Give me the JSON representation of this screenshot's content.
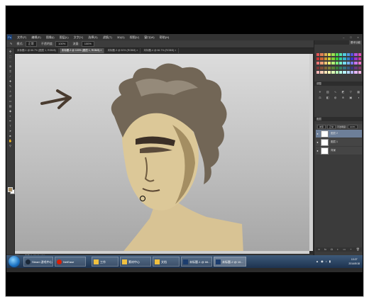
{
  "menubar": {
    "app_icon": "Ps",
    "items": [
      "文件(F)",
      "编辑(E)",
      "图像(I)",
      "图层(L)",
      "文字(Y)",
      "选择(S)",
      "滤镜(T)",
      "3D(D)",
      "视图(V)",
      "窗口(W)",
      "帮助(H)"
    ],
    "window_controls": [
      "–",
      "□",
      "×"
    ]
  },
  "options_bar": {
    "mode_label": "模式:",
    "mode_value": "正常",
    "opacity_label": "不透明度:",
    "opacity_value": "100%",
    "flow_label": "流量:",
    "flow_value": "100%"
  },
  "document_tabs": [
    {
      "label": "未标题-1 @ 66.7% (图层 1, RGB/8)",
      "active": false
    },
    {
      "label": "未标题-2 @ 100% (图层 1, RGB/8) ×",
      "active": true
    },
    {
      "label": "未标题-3 @ 50% (RGB/8) ×",
      "active": false
    },
    {
      "label": "未标题-4 @ 66.7% (RGB/8) ×",
      "active": false
    }
  ],
  "status_bar": {
    "zoom": "20%",
    "doc_size": "文档:3.43M/2.46M"
  },
  "panels": {
    "workspace": "基本功能",
    "adjustments_title": "调整",
    "layers_title": "图层",
    "layers_kind": "类型",
    "layers_mode": "正常",
    "opacity_label": "不透明度:",
    "opacity_value": "100%",
    "layers": [
      {
        "name": "图层 2",
        "selected": true
      },
      {
        "name": "图层 1",
        "selected": false
      },
      {
        "name": "背景",
        "selected": false
      }
    ]
  },
  "taskbar": {
    "buttons": [
      {
        "label": "Steam 游戏中心",
        "icon": "steam-icon"
      },
      {
        "label": "NetEase",
        "icon": "netease-icon"
      },
      {
        "label": "工作",
        "icon": "folder-icon"
      },
      {
        "label": "素材中心",
        "icon": "folder-icon"
      },
      {
        "label": "文档",
        "icon": "folder-icon"
      },
      {
        "label": "未标题-1 @ 66...",
        "icon": "photoshop-icon"
      },
      {
        "label": "未标题-2 @ 10...",
        "icon": "photoshop-icon"
      }
    ],
    "clock_time": "13:27",
    "clock_date": "2014/5/18"
  },
  "colors": {
    "foreground": "#a88e63",
    "background": "#ffffff",
    "ps_dark": "#3b3b3b",
    "selected_layer": "#6d7f99"
  }
}
